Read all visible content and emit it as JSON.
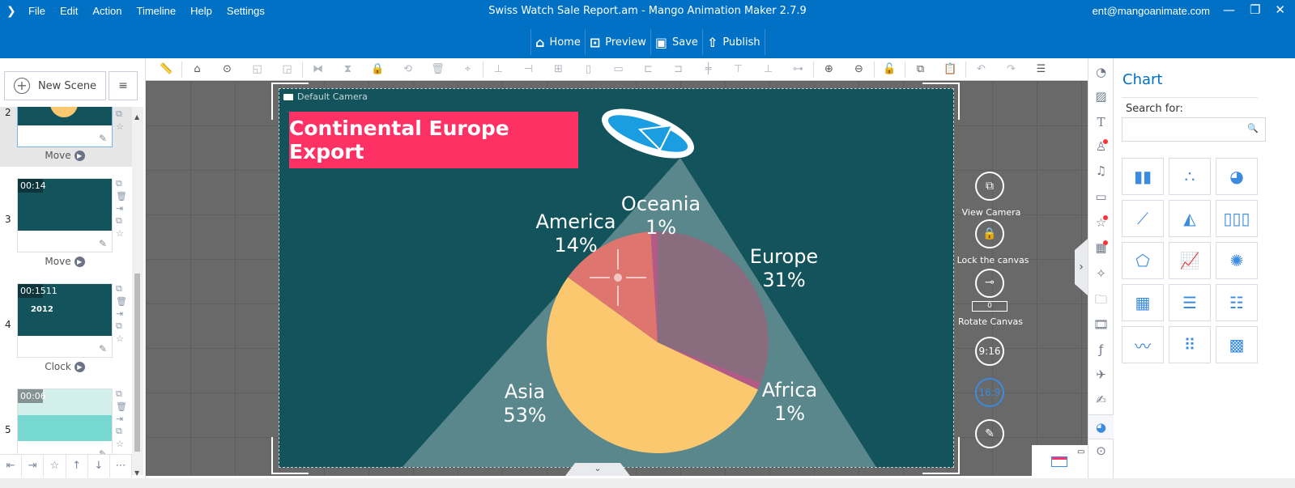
{
  "window": {
    "title": "Swiss Watch Sale Report.am - Mango Animation Maker 2.7.9",
    "user_email": "ent@mangoanimate.com",
    "controls": [
      "minimize",
      "restore",
      "close"
    ]
  },
  "menu": [
    "File",
    "Edit",
    "Action",
    "Timeline",
    "Help",
    "Settings"
  ],
  "quickbar": [
    {
      "label": "Home",
      "icon": "home-icon"
    },
    {
      "label": "Preview",
      "icon": "preview-icon"
    },
    {
      "label": "Save",
      "icon": "save-icon"
    },
    {
      "label": "Publish",
      "icon": "publish-icon"
    }
  ],
  "left_panel": {
    "new_scene_label": "New Scene",
    "scenes": [
      {
        "number": "2",
        "time": "",
        "transition": "Move",
        "selected": true
      },
      {
        "number": "3",
        "time": "00:14",
        "transition": "Move",
        "selected": false
      },
      {
        "number": "4",
        "time": "00:1511",
        "thumb_text": "2012",
        "transition": "Clock",
        "selected": false
      },
      {
        "number": "5",
        "time": "00:06",
        "transition": "",
        "selected": false
      }
    ]
  },
  "toolbar_icons": [
    "ruler",
    "home",
    "more",
    "bring-forward",
    "send-backward",
    "flip",
    "mirror",
    "lock",
    "replace",
    "delete",
    "lock-location",
    "align-v-center",
    "align-h-center",
    "fit",
    "distribute-v",
    "distribute-h",
    "align-left",
    "align-right",
    "align-center",
    "align-top",
    "align-bottom",
    "align-middle",
    "zoom-in",
    "zoom-out",
    "lock-canvas",
    "copy",
    "paste",
    "undo",
    "redo",
    "timeline-settings"
  ],
  "canvas": {
    "camera_label": "Default Camera",
    "slide_title": "Continental Europe Export",
    "title_color": "#fe3164",
    "background_color": "#13535c"
  },
  "chart_data": {
    "type": "pie",
    "title": "Continental Europe Export",
    "categories": [
      "Europe",
      "Africa",
      "Asia",
      "America",
      "Oceania"
    ],
    "values": [
      31,
      1,
      53,
      14,
      1
    ],
    "labels": [
      "31%",
      "1%",
      "53%",
      "14%",
      "1%"
    ],
    "colors": [
      "#896d7f",
      "#b35a86",
      "#fbc870",
      "#de756f",
      "#b35a86"
    ]
  },
  "canvas_tools": {
    "view_camera": "View Camera",
    "lock_canvas": "Lock the canvas",
    "rotate_canvas": "Rotate Canvas",
    "rotate_value": "0",
    "ratio_portrait": "9:16",
    "ratio_landscape": "16:9",
    "active_ratio": "16:9"
  },
  "right_panel": {
    "title": "Chart",
    "search_label": "Search for:",
    "search_value": "",
    "chart_types": [
      "bar",
      "scatter",
      "pie",
      "line",
      "area",
      "stacked-bar",
      "radar",
      "combo",
      "sunburst",
      "table",
      "horizontal-bar",
      "stacked-horizontal-bar",
      "multi-line",
      "dot-plot",
      "heatmap"
    ]
  },
  "rail_icons": [
    "shape",
    "image",
    "text",
    "character",
    "music",
    "speech-bubble",
    "sticker",
    "photo",
    "effects",
    "folder",
    "video",
    "flash",
    "plane",
    "character-edit",
    "chart",
    "more"
  ]
}
